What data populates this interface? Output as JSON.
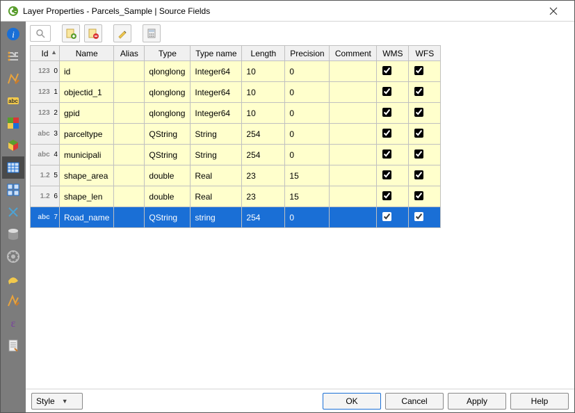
{
  "window": {
    "title": "Layer Properties - Parcels_Sample | Source Fields"
  },
  "search": {
    "placeholder": ""
  },
  "columns": {
    "id": "Id",
    "name": "Name",
    "alias": "Alias",
    "type": "Type",
    "typename": "Type name",
    "length": "Length",
    "precision": "Precision",
    "comment": "Comment",
    "wms": "WMS",
    "wfs": "WFS"
  },
  "colwidths": {
    "rowhead": 42,
    "name": 76,
    "alias": 44,
    "type": 66,
    "typename": 74,
    "length": 62,
    "precision": 64,
    "comment": 68,
    "wms": 46,
    "wfs": 46
  },
  "rows": [
    {
      "idx": "0",
      "typetag": "123",
      "name": "id",
      "alias": "",
      "type": "qlonglong",
      "typename": "Integer64",
      "length": "10",
      "precision": "0",
      "comment": "",
      "wms": true,
      "wfs": true,
      "selected": false
    },
    {
      "idx": "1",
      "typetag": "123",
      "name": "objectid_1",
      "alias": "",
      "type": "qlonglong",
      "typename": "Integer64",
      "length": "10",
      "precision": "0",
      "comment": "",
      "wms": true,
      "wfs": true,
      "selected": false
    },
    {
      "idx": "2",
      "typetag": "123",
      "name": "gpid",
      "alias": "",
      "type": "qlonglong",
      "typename": "Integer64",
      "length": "10",
      "precision": "0",
      "comment": "",
      "wms": true,
      "wfs": true,
      "selected": false
    },
    {
      "idx": "3",
      "typetag": "abc",
      "name": "parceltype",
      "alias": "",
      "type": "QString",
      "typename": "String",
      "length": "254",
      "precision": "0",
      "comment": "",
      "wms": true,
      "wfs": true,
      "selected": false
    },
    {
      "idx": "4",
      "typetag": "abc",
      "name": "municipali",
      "alias": "",
      "type": "QString",
      "typename": "String",
      "length": "254",
      "precision": "0",
      "comment": "",
      "wms": true,
      "wfs": true,
      "selected": false
    },
    {
      "idx": "5",
      "typetag": "1.2",
      "name": "shape_area",
      "alias": "",
      "type": "double",
      "typename": "Real",
      "length": "23",
      "precision": "15",
      "comment": "",
      "wms": true,
      "wfs": true,
      "selected": false
    },
    {
      "idx": "6",
      "typetag": "1.2",
      "name": "shape_len",
      "alias": "",
      "type": "double",
      "typename": "Real",
      "length": "23",
      "precision": "15",
      "comment": "",
      "wms": true,
      "wfs": true,
      "selected": false
    },
    {
      "idx": "7",
      "typetag": "abc",
      "name": "Road_name",
      "alias": "",
      "type": "QString",
      "typename": "string",
      "length": "254",
      "precision": "0",
      "comment": "",
      "wms": true,
      "wfs": true,
      "selected": true
    }
  ],
  "buttons": {
    "style": "Style",
    "ok": "OK",
    "cancel": "Cancel",
    "apply": "Apply",
    "help": "Help"
  },
  "sidebar": {
    "items": [
      {
        "key": "information",
        "active": false
      },
      {
        "key": "source",
        "active": false
      },
      {
        "key": "symbology",
        "active": false
      },
      {
        "key": "labels",
        "active": false
      },
      {
        "key": "diagrams",
        "active": false
      },
      {
        "key": "3dview",
        "active": false
      },
      {
        "key": "sourcefields",
        "active": true
      },
      {
        "key": "attrforms",
        "active": false
      },
      {
        "key": "joins",
        "active": false
      },
      {
        "key": "auxstorage",
        "active": false
      },
      {
        "key": "actions",
        "active": false
      },
      {
        "key": "display",
        "active": false
      },
      {
        "key": "rendering",
        "active": false
      },
      {
        "key": "variables",
        "active": false
      },
      {
        "key": "metadata",
        "active": false
      }
    ]
  }
}
